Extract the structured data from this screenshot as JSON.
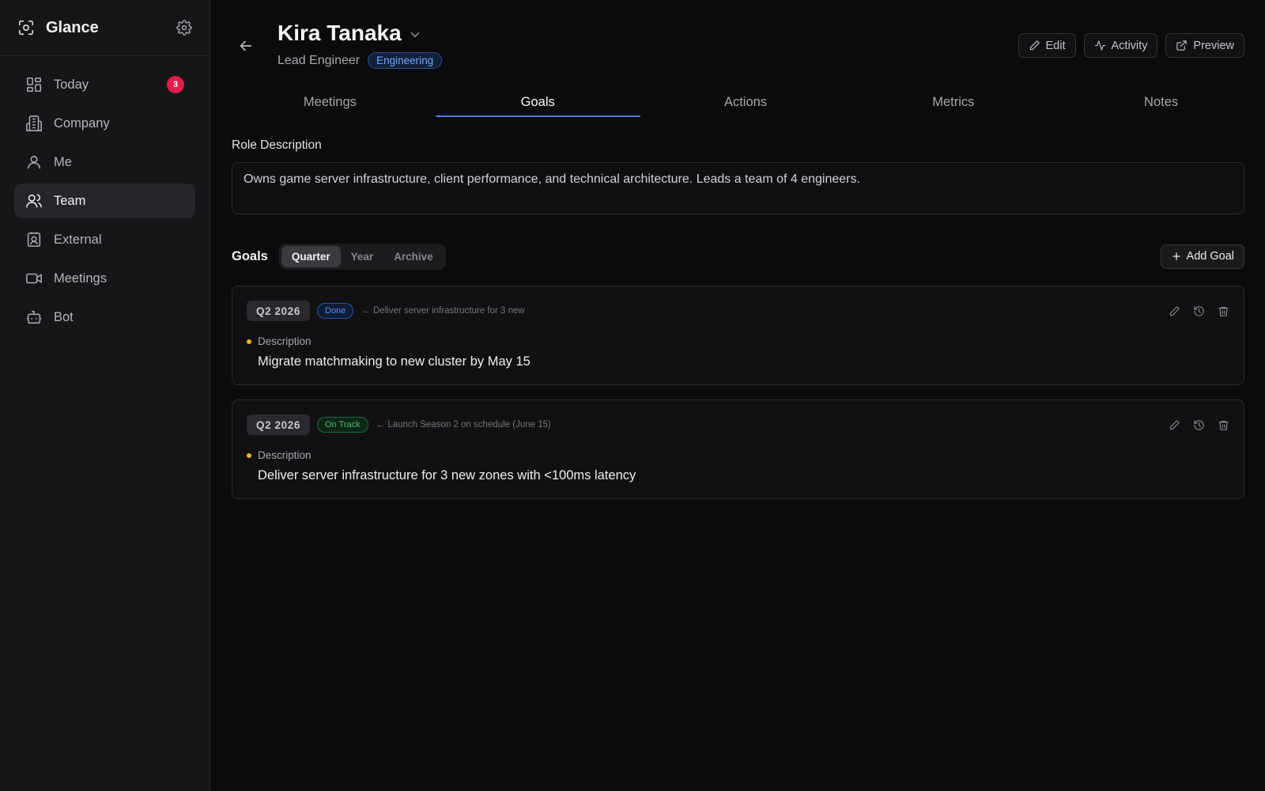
{
  "app": {
    "name": "Glance"
  },
  "sidebar": {
    "items": [
      {
        "label": "Today",
        "icon": "dashboard-icon",
        "badge": "3"
      },
      {
        "label": "Company",
        "icon": "building-icon"
      },
      {
        "label": "Me",
        "icon": "user-icon"
      },
      {
        "label": "Team",
        "icon": "users-icon",
        "active": true
      },
      {
        "label": "External",
        "icon": "contact-card-icon"
      },
      {
        "label": "Meetings",
        "icon": "video-icon"
      },
      {
        "label": "Bot",
        "icon": "bot-icon"
      }
    ]
  },
  "header": {
    "name": "Kira Tanaka",
    "role": "Lead Engineer",
    "department": "Engineering",
    "actions": {
      "edit": "Edit",
      "activity": "Activity",
      "preview": "Preview"
    }
  },
  "tabs": [
    {
      "label": "Meetings"
    },
    {
      "label": "Goals",
      "active": true
    },
    {
      "label": "Actions"
    },
    {
      "label": "Metrics"
    },
    {
      "label": "Notes"
    }
  ],
  "role_description": {
    "label": "Role Description",
    "text": "Owns game server infrastructure, client performance, and technical architecture. Leads a team of 4 engineers."
  },
  "goals": {
    "title": "Goals",
    "filters": [
      "Quarter",
      "Year",
      "Archive"
    ],
    "active_filter": "Quarter",
    "add_label": "Add Goal",
    "items": [
      {
        "period": "Q2 2026",
        "status": "Done",
        "parent": "← Deliver server infrastructure for 3 new",
        "desc_label": "Description",
        "description": "Migrate matchmaking to new cluster by May 15"
      },
      {
        "period": "Q2 2026",
        "status": "On Track",
        "parent": "← Launch Season 2 on schedule (June 15)",
        "desc_label": "Description",
        "description": "Deliver server infrastructure for 3 new zones with <100ms latency"
      }
    ]
  },
  "colors": {
    "accent": "#4f7de0",
    "badge": "#e11d48",
    "done": "#5b8def",
    "on_track": "#3ec46d",
    "dot": "#f5b61e"
  }
}
